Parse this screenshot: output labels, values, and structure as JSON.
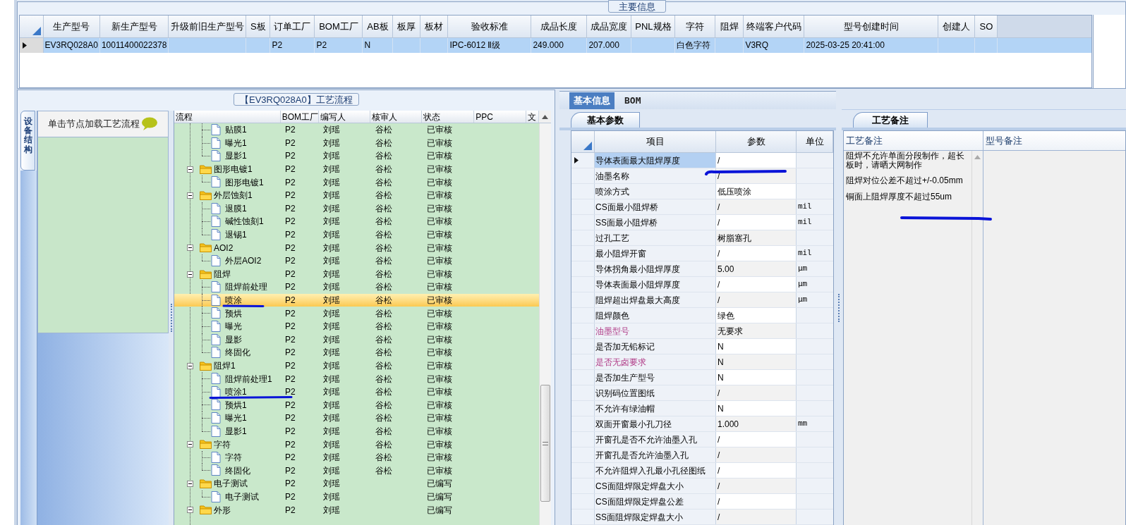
{
  "main_info": {
    "title": "主要信息",
    "columns": [
      "生产型号",
      "新生产型号",
      "升级前旧生产型号",
      "S板",
      "订单工厂",
      "BOM工厂",
      "AB板",
      "板厚",
      "板材",
      "验收标准",
      "成品长度",
      "成品宽度",
      "PNL规格",
      "字符",
      "阻焊",
      "终端客户代码",
      "型号创建时间",
      "创建人",
      "SO"
    ],
    "rows": [
      {
        "selected": true,
        "cells": [
          "EV3RQ028A0",
          "10011400022378",
          null,
          null,
          "P2",
          "P2",
          "N",
          null,
          null,
          "IPC-6012 Ⅱ级",
          "249.000",
          "207.000",
          null,
          "白色字符",
          null,
          "V3RQ",
          "2025-03-25 20:41:00",
          null,
          null
        ]
      }
    ]
  },
  "process_flow": {
    "title": "【EV3RQ028A0】工艺流程",
    "side_tab": "设备结构",
    "hint": "单击节点加载工艺流程",
    "columns": [
      "流程",
      "BOM工厂",
      "编写人",
      "核审人",
      "状态",
      "PPC",
      "文"
    ],
    "tree": [
      {
        "children": [
          {
            "kind": "file",
            "label": "贴膜1",
            "bom": "P2",
            "writer": "刘瑶",
            "reviewer": "谷松",
            "status": "已审核",
            "selected": false
          },
          {
            "kind": "file",
            "label": "曝光1",
            "bom": "P2",
            "writer": "刘瑶",
            "reviewer": "谷松",
            "status": "已审核",
            "selected": false
          },
          {
            "kind": "file",
            "label": "显影1",
            "bom": "P2",
            "writer": "刘瑶",
            "reviewer": "谷松",
            "status": "已审核",
            "selected": false
          }
        ]
      },
      {
        "kind": "folder",
        "label": "图形电镀1",
        "bom": "P2",
        "writer": "刘瑶",
        "reviewer": "谷松",
        "status": "已审核",
        "selected": false,
        "expanded": true,
        "children": [
          {
            "kind": "file",
            "label": "图形电镀1",
            "bom": "P2",
            "writer": "刘瑶",
            "reviewer": "谷松",
            "status": "已审核",
            "selected": false
          }
        ]
      },
      {
        "kind": "folder",
        "label": "外层蚀刻1",
        "bom": "P2",
        "writer": "刘瑶",
        "reviewer": "谷松",
        "status": "已审核",
        "selected": false,
        "expanded": true,
        "children": [
          {
            "kind": "file",
            "label": "退膜1",
            "bom": "P2",
            "writer": "刘瑶",
            "reviewer": "谷松",
            "status": "已审核",
            "selected": false
          },
          {
            "kind": "file",
            "label": "碱性蚀刻1",
            "bom": "P2",
            "writer": "刘瑶",
            "reviewer": "谷松",
            "status": "已审核",
            "selected": false
          },
          {
            "kind": "file",
            "label": "退锡1",
            "bom": "P2",
            "writer": "刘瑶",
            "reviewer": "谷松",
            "status": "已审核",
            "selected": false
          }
        ]
      },
      {
        "kind": "folder",
        "label": "AOI2",
        "bom": "P2",
        "writer": "刘瑶",
        "reviewer": "谷松",
        "status": "已审核",
        "selected": false,
        "expanded": true,
        "children": [
          {
            "kind": "file",
            "label": "外层AOI2",
            "bom": "P2",
            "writer": "刘瑶",
            "reviewer": "谷松",
            "status": "已审核",
            "selected": false
          }
        ]
      },
      {
        "kind": "folder",
        "label": "阻焊",
        "bom": "P2",
        "writer": "刘瑶",
        "reviewer": "谷松",
        "status": "已审核",
        "selected": false,
        "expanded": true,
        "children": [
          {
            "kind": "file",
            "label": "阻焊前处理",
            "bom": "P2",
            "writer": "刘瑶",
            "reviewer": "谷松",
            "status": "已审核",
            "selected": false
          },
          {
            "kind": "file",
            "label": "喷涂",
            "bom": "P2",
            "writer": "刘瑶",
            "reviewer": "谷松",
            "status": "已审核",
            "selected": true
          },
          {
            "kind": "file",
            "label": "预烘",
            "bom": "P2",
            "writer": "刘瑶",
            "reviewer": "谷松",
            "status": "已审核",
            "selected": false
          },
          {
            "kind": "file",
            "label": "曝光",
            "bom": "P2",
            "writer": "刘瑶",
            "reviewer": "谷松",
            "status": "已审核",
            "selected": false
          },
          {
            "kind": "file",
            "label": "显影",
            "bom": "P2",
            "writer": "刘瑶",
            "reviewer": "谷松",
            "status": "已审核",
            "selected": false
          },
          {
            "kind": "file",
            "label": "终固化",
            "bom": "P2",
            "writer": "刘瑶",
            "reviewer": "谷松",
            "status": "已审核",
            "selected": false
          }
        ]
      },
      {
        "kind": "folder",
        "label": "阻焊1",
        "bom": "P2",
        "writer": "刘瑶",
        "reviewer": "谷松",
        "status": "已审核",
        "selected": false,
        "expanded": true,
        "children": [
          {
            "kind": "file",
            "label": "阻焊前处理1",
            "bom": "P2",
            "writer": "刘瑶",
            "reviewer": "谷松",
            "status": "已审核",
            "selected": false
          },
          {
            "kind": "file",
            "label": "喷涂1",
            "bom": "P2",
            "writer": "刘瑶",
            "reviewer": "谷松",
            "status": "已审核",
            "selected": false
          },
          {
            "kind": "file",
            "label": "预烘1",
            "bom": "P2",
            "writer": "刘瑶",
            "reviewer": "谷松",
            "status": "已审核",
            "selected": false
          },
          {
            "kind": "file",
            "label": "曝光1",
            "bom": "P2",
            "writer": "刘瑶",
            "reviewer": "谷松",
            "status": "已审核",
            "selected": false
          },
          {
            "kind": "file",
            "label": "显影1",
            "bom": "P2",
            "writer": "刘瑶",
            "reviewer": "谷松",
            "status": "已审核",
            "selected": false
          }
        ]
      },
      {
        "kind": "folder",
        "label": "字符",
        "bom": "P2",
        "writer": "刘瑶",
        "reviewer": "谷松",
        "status": "已审核",
        "selected": false,
        "expanded": true,
        "children": [
          {
            "kind": "file",
            "label": "字符",
            "bom": "P2",
            "writer": "刘瑶",
            "reviewer": "谷松",
            "status": "已审核",
            "selected": false
          },
          {
            "kind": "file",
            "label": "终固化",
            "bom": "P2",
            "writer": "刘瑶",
            "reviewer": "谷松",
            "status": "已审核",
            "selected": false
          }
        ]
      },
      {
        "kind": "folder",
        "label": "电子测试",
        "bom": "P2",
        "writer": "刘瑶",
        "status": "已编写",
        "selected": false,
        "expanded": true,
        "children": [
          {
            "kind": "file",
            "label": "电子测试",
            "bom": "P2",
            "writer": "刘瑶",
            "status": "已编写",
            "selected": false
          }
        ]
      },
      {
        "kind": "folder",
        "label": "外形",
        "bom": "P2",
        "writer": "刘瑶",
        "status": "已编写",
        "selected": false,
        "expanded": true
      }
    ]
  },
  "detail": {
    "tabs": [
      {
        "label": "基本信息",
        "selected": true
      },
      {
        "label": "BOM",
        "selected": false
      }
    ],
    "subtab": "基本参数",
    "columns": [
      "项目",
      "参数",
      "单位"
    ],
    "rows": [
      {
        "item": "导体表面最大阻焊厚度",
        "value": "/",
        "selected": true,
        "flagged": false
      },
      {
        "item": "油墨名称",
        "value": "/",
        "selected": false,
        "flagged": false
      },
      {
        "item": "喷涂方式",
        "value": "低压喷涂",
        "selected": false,
        "flagged": false
      },
      {
        "item": "CS面最小阻焊桥",
        "value": "/",
        "unit": "mil",
        "selected": false,
        "flagged": false
      },
      {
        "item": "SS面最小阻焊桥",
        "value": "/",
        "unit": "mil",
        "selected": false,
        "flagged": false
      },
      {
        "item": "过孔工艺",
        "value": "树脂塞孔",
        "selected": false,
        "flagged": false
      },
      {
        "item": "最小阻焊开窗",
        "value": "/",
        "unit": "mil",
        "selected": false,
        "flagged": false
      },
      {
        "item": "导体拐角最小阻焊厚度",
        "value": "5.00",
        "unit": "μm",
        "selected": false,
        "flagged": false
      },
      {
        "item": "导体表面最小阻焊厚度",
        "value": "/",
        "unit": "μm",
        "selected": false,
        "flagged": false
      },
      {
        "item": "阻焊超出焊盘最大高度",
        "value": "/",
        "unit": "μm",
        "selected": false,
        "flagged": false
      },
      {
        "item": "阻焊颜色",
        "value": "绿色",
        "selected": false,
        "flagged": false
      },
      {
        "item": "油墨型号",
        "value": "无要求",
        "selected": false,
        "flagged": true
      },
      {
        "item": "是否加无铅标记",
        "value": "N",
        "selected": false,
        "flagged": false
      },
      {
        "item": "是否无卤要求",
        "value": "N",
        "selected": false,
        "flagged": true
      },
      {
        "item": "是否加生产型号",
        "value": "N",
        "selected": false,
        "flagged": false
      },
      {
        "item": "识别码位置图纸",
        "value": "/",
        "selected": false,
        "flagged": false
      },
      {
        "item": "不允许有绿油帽",
        "value": "N",
        "selected": false,
        "flagged": false
      },
      {
        "item": "双面开窗最小孔刀径",
        "value": "1.000",
        "unit": "mm",
        "selected": false,
        "flagged": false
      },
      {
        "item": "开窗孔是否不允许油墨入孔",
        "value": "/",
        "selected": false,
        "flagged": false
      },
      {
        "item": "开窗孔是否允许油墨入孔",
        "value": "/",
        "selected": false,
        "flagged": false
      },
      {
        "item": "不允许阻焊入孔最小孔径图纸",
        "value": "/",
        "selected": false,
        "flagged": false
      },
      {
        "item": "CS面阻焊限定焊盘大小",
        "value": "/",
        "selected": false,
        "flagged": false
      },
      {
        "item": "CS面阻焊限定焊盘公差",
        "value": "/",
        "selected": false,
        "flagged": false
      },
      {
        "item": "SS面阻焊限定焊盘大小",
        "value": "/",
        "selected": false,
        "flagged": false
      }
    ]
  },
  "remarks": {
    "tab": "工艺备注",
    "columns": [
      "工艺备注",
      "型号备注"
    ],
    "notes": [
      "阻焊不允许单面分段制作，超长板时，请晒大网制作",
      "阻焊对位公差不超过+/-0.05mm",
      "铜面上阻焊厚度不超过55um"
    ]
  }
}
